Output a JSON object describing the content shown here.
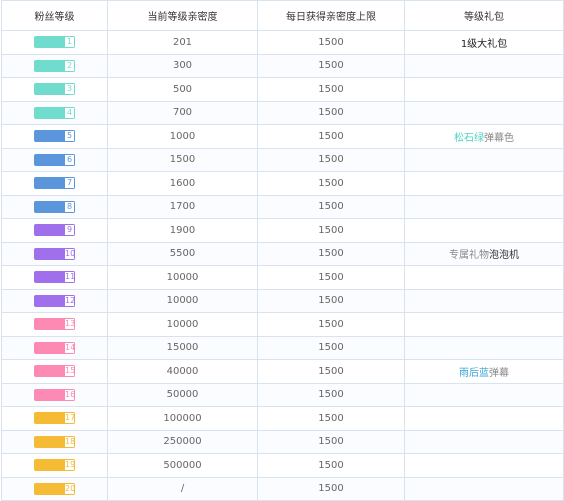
{
  "headers": [
    "粉丝等级",
    "当前等级亲密度",
    "每日获得亲密度上限",
    "等级礼包"
  ],
  "colors": {
    "teal": "#6fdcce",
    "blue": "#5b95dc",
    "purple": "#a070ec",
    "pink": "#fd8ab3",
    "yellow": "#f5bb35",
    "teal_text": "#4ed0c2",
    "blue_text": "#35a3d7"
  },
  "rows": [
    {
      "level": "1",
      "intimacy": "201",
      "daily_cap": "1500",
      "color": "#6fdcce"
    },
    {
      "level": "2",
      "intimacy": "300",
      "daily_cap": "1500",
      "color": "#6fdcce"
    },
    {
      "level": "3",
      "intimacy": "500",
      "daily_cap": "1500",
      "color": "#6fdcce"
    },
    {
      "level": "4",
      "intimacy": "700",
      "daily_cap": "1500",
      "color": "#6fdcce"
    },
    {
      "level": "5",
      "intimacy": "1000",
      "daily_cap": "1500",
      "color": "#5b95dc"
    },
    {
      "level": "6",
      "intimacy": "1500",
      "daily_cap": "1500",
      "color": "#5b95dc"
    },
    {
      "level": "7",
      "intimacy": "1600",
      "daily_cap": "1500",
      "color": "#5b95dc"
    },
    {
      "level": "8",
      "intimacy": "1700",
      "daily_cap": "1500",
      "color": "#5b95dc"
    },
    {
      "level": "9",
      "intimacy": "1900",
      "daily_cap": "1500",
      "color": "#a070ec"
    },
    {
      "level": "10",
      "intimacy": "5500",
      "daily_cap": "1500",
      "color": "#a070ec"
    },
    {
      "level": "11",
      "intimacy": "10000",
      "daily_cap": "1500",
      "color": "#a070ec"
    },
    {
      "level": "12",
      "intimacy": "10000",
      "daily_cap": "1500",
      "color": "#a070ec"
    },
    {
      "level": "13",
      "intimacy": "10000",
      "daily_cap": "1500",
      "color": "#fd8ab3"
    },
    {
      "level": "14",
      "intimacy": "15000",
      "daily_cap": "1500",
      "color": "#fd8ab3"
    },
    {
      "level": "15",
      "intimacy": "40000",
      "daily_cap": "1500",
      "color": "#fd8ab3"
    },
    {
      "level": "16",
      "intimacy": "50000",
      "daily_cap": "1500",
      "color": "#fd8ab3"
    },
    {
      "level": "17",
      "intimacy": "100000",
      "daily_cap": "1500",
      "color": "#f5bb35"
    },
    {
      "level": "18",
      "intimacy": "250000",
      "daily_cap": "1500",
      "color": "#f5bb35"
    },
    {
      "level": "19",
      "intimacy": "500000",
      "daily_cap": "1500",
      "color": "#f5bb35"
    },
    {
      "level": "20",
      "intimacy": "/",
      "daily_cap": "1500",
      "color": "#f5bb35"
    }
  ],
  "gifts": {
    "r1": "1级大礼包",
    "r5_colored": "松石绿",
    "r5_rest": "弹幕色",
    "r10_prefix": "专属礼物",
    "r10_bold": "泡泡机",
    "r15_colored": "雨后蓝",
    "r15_rest": "弹幕"
  }
}
